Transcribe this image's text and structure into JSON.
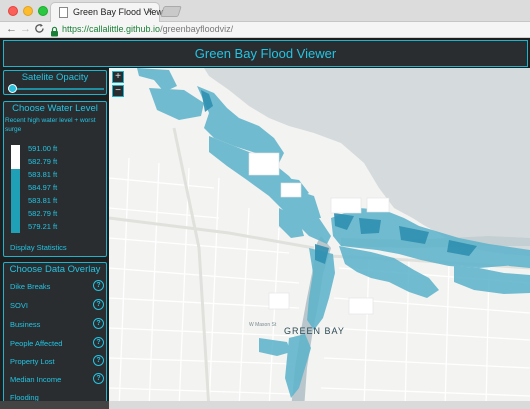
{
  "browser": {
    "tab_title": "Green Bay Flood Viewer",
    "tab_close": "×",
    "url_host": "https://callalittle.github.io",
    "url_path": "/greenbayfloodviz/",
    "back_glyph": "←",
    "forward_glyph": "→",
    "reload_glyph": "C"
  },
  "app": {
    "title": "Green Bay Flood Viewer"
  },
  "opacity_panel": {
    "title": "Satelite Opacity",
    "value": 0
  },
  "zoom": {
    "in_label": "+",
    "out_label": "−"
  },
  "water_panel": {
    "title": "Choose Water Level",
    "description": "Recent high water level + worst surge",
    "levels": [
      "591.00 ft",
      "582.79 ft",
      "583.81 ft",
      "584.97 ft",
      "583.81 ft",
      "582.79 ft",
      "579.21 ft"
    ],
    "stats_label": "Display Statistics"
  },
  "overlay_panel": {
    "title": "Choose Data Overlay",
    "help_glyph": "?",
    "items": [
      {
        "label": "Dike Breaks"
      },
      {
        "label": "SOVI"
      },
      {
        "label": "Business"
      },
      {
        "label": "People Affected"
      },
      {
        "label": "Property Lost"
      },
      {
        "label": "Median Income"
      },
      {
        "label": "Flooding"
      }
    ]
  },
  "map": {
    "city_label": "GREEN BAY",
    "street_label": "W Mason St"
  },
  "colors": {
    "accent": "#23c4e4",
    "panel_bg": "#2a2d2f",
    "flood": "#5fb4cc",
    "flood_deep": "#2f8fb0",
    "water": "#d5dadd",
    "land": "#f3f3f1"
  }
}
